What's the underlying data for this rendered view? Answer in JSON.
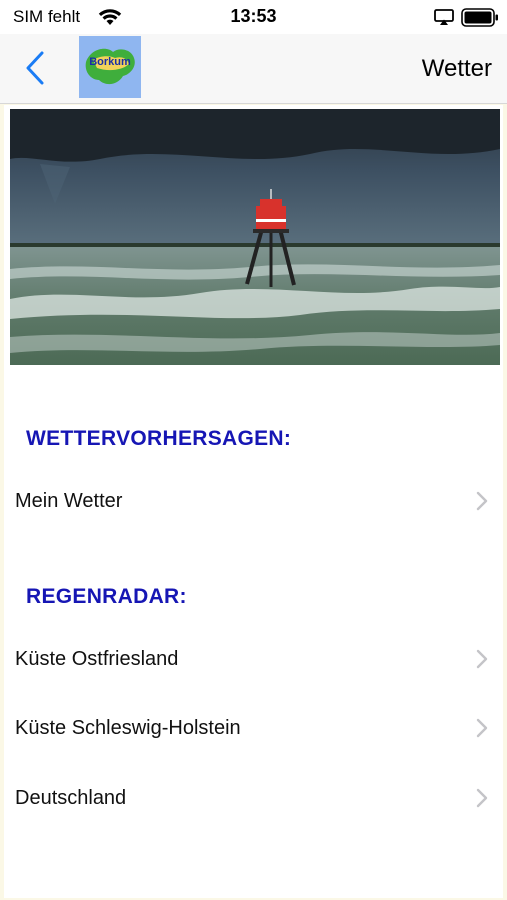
{
  "status_bar": {
    "carrier": "SIM fehlt",
    "time": "13:53",
    "icons": [
      "wifi-icon",
      "airplay-icon",
      "battery-icon"
    ]
  },
  "nav": {
    "back_icon": "chevron-left-icon",
    "logo_text": "Borkum",
    "title": "Wetter"
  },
  "hero": {
    "subject": "red lighthouse in stormy sea under dark clouds"
  },
  "sections": [
    {
      "header": "WETTERVORHERSAGEN:",
      "items": [
        {
          "label": "Mein Wetter"
        }
      ]
    },
    {
      "header": "REGENRADAR:",
      "items": [
        {
          "label": "Küste Ostfriesland"
        },
        {
          "label": "Küste Schleswig-Holstein"
        },
        {
          "label": "Deutschland"
        }
      ]
    }
  ],
  "colors": {
    "accent_blue": "#1a7cf5",
    "section_header": "#1616b4",
    "background": "#fbf8e6"
  }
}
